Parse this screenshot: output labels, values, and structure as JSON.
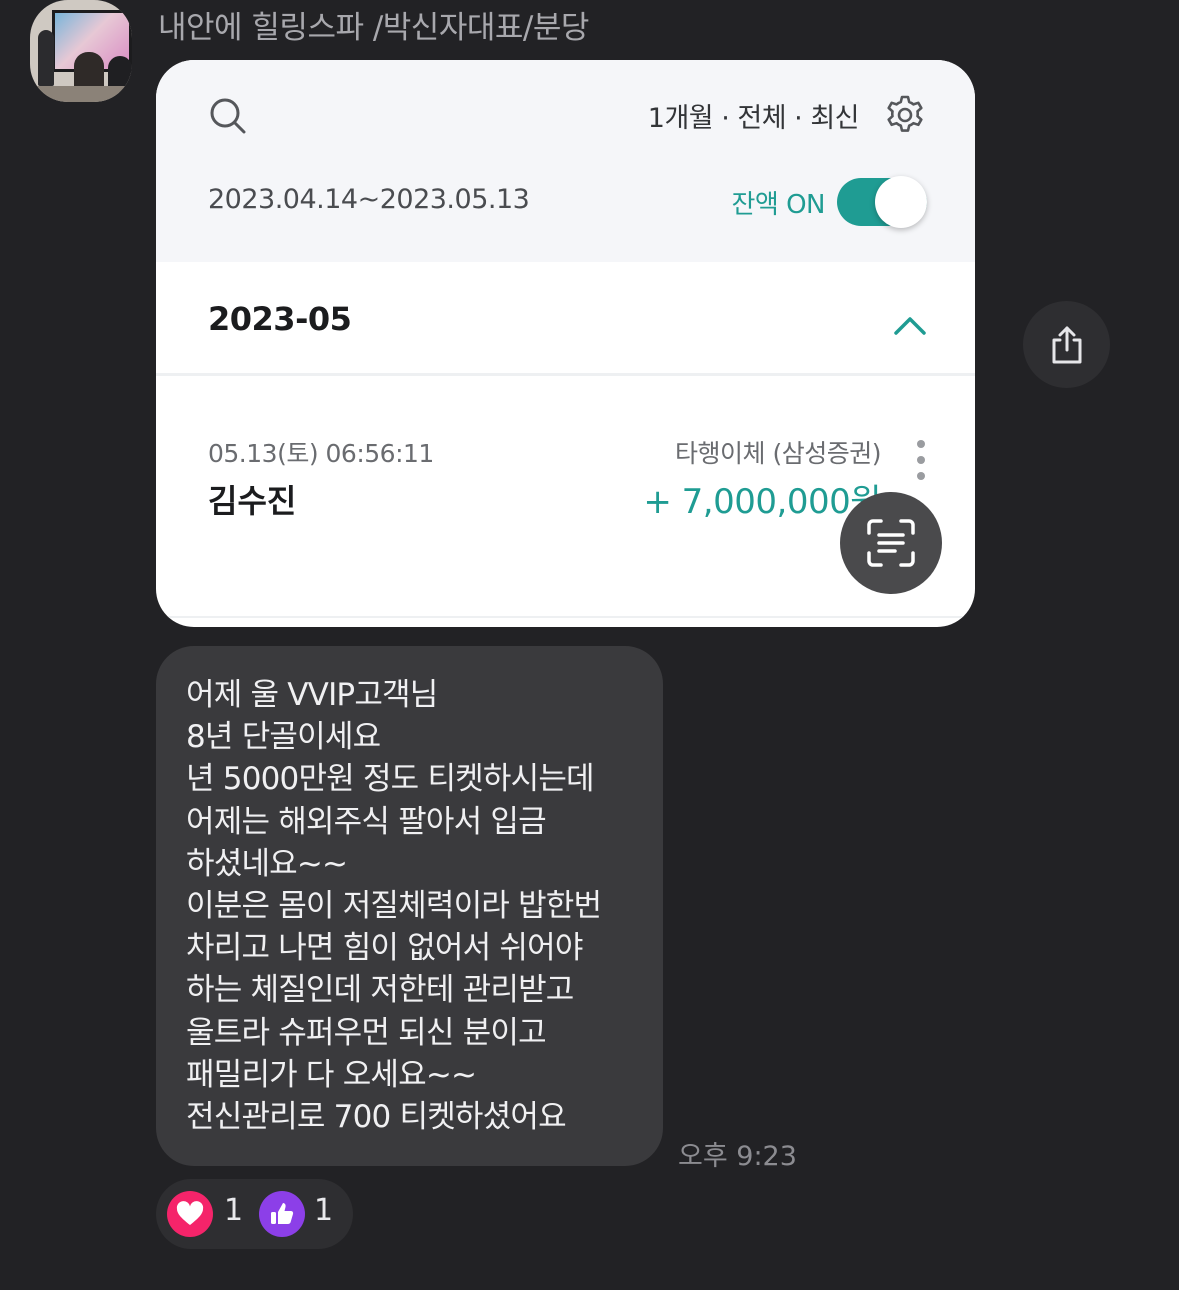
{
  "message": {
    "sender_name": "내안에 힐링스파 /박신자대표/분당",
    "timestamp": "오후 9:23",
    "text_lines": [
      "어제 울 VVIP고객님",
      "8년 단골이세요",
      "년 5000만원 정도 티켓하시는데",
      "어제는 해외주식 팔아서 입금",
      "하셨네요~~",
      "이분은 몸이 저질체력이라 밥한번",
      "차리고 나면 힘이 없어서 쉬어야",
      "하는 체질인데 저한테 관리받고",
      "울트라 슈퍼우먼 되신 분이고",
      "패밀리가 다 오세요~~",
      "전신관리로 700 티켓하셨어요"
    ],
    "reactions": {
      "heart_count": "1",
      "like_count": "1"
    }
  },
  "bank_screenshot": {
    "filter": "1개월 · 전체 · 최신",
    "date_range": "2023.04.14~2023.05.13",
    "balance_toggle_label": "잔액 ON",
    "balance_toggle_on": true,
    "month": "2023-05",
    "transaction": {
      "datetime": "05.13(토) 06:56:11",
      "name": "김수진",
      "type": "타행이체 (삼성증권)",
      "amount": "+ 7,000,000원"
    }
  },
  "colors": {
    "background": "#222225",
    "bubble": "#3a3a3d",
    "accent_teal": "#1f9c93",
    "heart": "#f5246a",
    "like": "#8c3fe8"
  },
  "icons": [
    "search-icon",
    "gear-icon",
    "chevron-up-icon",
    "more-vertical-icon",
    "text-scan-icon",
    "share-icon",
    "heart-icon",
    "thumbs-up-icon"
  ]
}
